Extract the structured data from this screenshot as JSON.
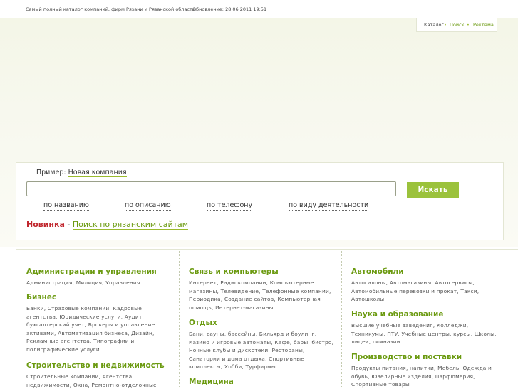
{
  "header": {
    "tagline": "Самый полный каталог компаний, фирм Рязани и Рязанской области.",
    "updated": "Обновление: 28.06.2011 19:51"
  },
  "nav": {
    "catalog": "Каталог",
    "sep": "•",
    "search": "Поиск",
    "ads": "Реклама"
  },
  "search": {
    "example_prefix": "Пример:",
    "example_link": "Новая компания",
    "input_value": "",
    "button_label": "Искать",
    "modes": [
      "по названию",
      "по описанию",
      "по телефону",
      "по виду деятельности"
    ],
    "promo_new": "Новинка",
    "promo_sep": "-",
    "promo_link": "Поиск по рязанским сайтам"
  },
  "catalog": {
    "col1": [
      {
        "title": "Администрации и управления",
        "links": "Администрация, Милиция, Управления"
      },
      {
        "title": "Бизнес",
        "links": "Банки, Страховые компании, Кадровые агентства, Юридические услуги, Аудит, бухгалтерский учет, Брокеры и управление активами, Автоматизация бизнеса, Дизайн, Рекламные агентства, Типографии и полиграфические услуги"
      },
      {
        "title": "Строительство и недвижимость",
        "links": "Строительные компании, Агентства недвижимости, Окна, Ремонтно-отделочные"
      }
    ],
    "col2": [
      {
        "title": "Связь и компьютеры",
        "links": "Интернет, Радиокомпании, Компьютерные магазины, Телевидение, Телефонные компании, Периодика, Создание сайтов, Компьютерная помощь, Интернет-магазины"
      },
      {
        "title": "Отдых",
        "links": "Бани, сауны, бассейны, Бильярд и боулинг, Казино и игровые автоматы, Кафе, бары, бистро, Ночные клубы и дискотеки, Рестораны, Санатории и дома отдыха, Спортивные комплексы, Хобби, Турфирмы"
      },
      {
        "title": "Медицина",
        "links": ""
      }
    ],
    "col3": [
      {
        "title": "Автомобили",
        "links": "Автосалоны, Автомагазины, Автосервисы, Автомобильные перевозки и прокат, Такси, Автошколы"
      },
      {
        "title": "Наука и образование",
        "links": "Высшие учебные заведения, Колледжи, Техникумы, ПТУ, Учебные центры, курсы, Школы, лицеи, гимназии"
      },
      {
        "title": "Производство и поставки",
        "links": "Продукты питания, напитки, Мебель, Одежда и обувь, Ювелирные изделия, Парфюмерия, Спортивные товары"
      }
    ]
  }
}
